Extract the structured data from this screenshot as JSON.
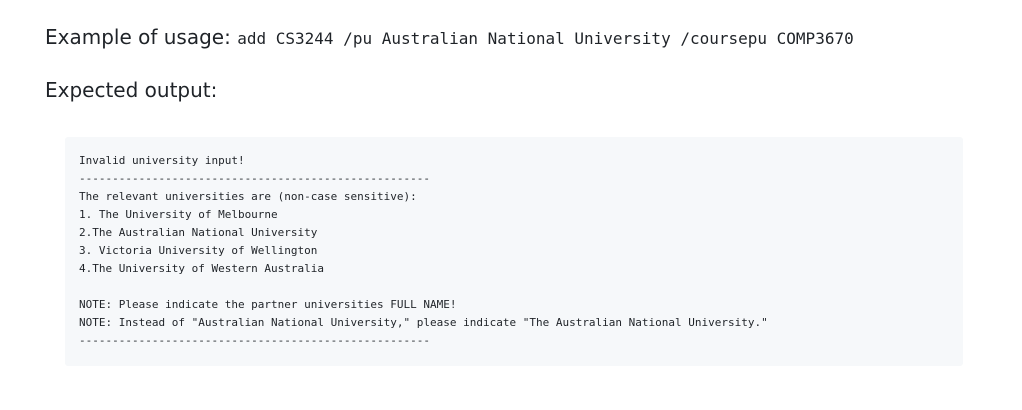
{
  "example": {
    "label": "Example of usage:",
    "command": "add CS3244 /pu Australian National University /coursepu COMP3670"
  },
  "expected": {
    "label": "Expected output:"
  },
  "output_lines": [
    "Invalid university input!",
    "-----------------------------------------------------",
    "The relevant universities are (non-case sensitive):",
    "1. The University of Melbourne",
    "2.The Australian National University",
    "3. Victoria University of Wellington",
    "4.The University of Western Australia",
    "",
    "NOTE: Please indicate the partner universities FULL NAME!",
    "NOTE: Instead of \"Australian National University,\" please indicate \"The Australian National University.\"",
    "-----------------------------------------------------"
  ]
}
